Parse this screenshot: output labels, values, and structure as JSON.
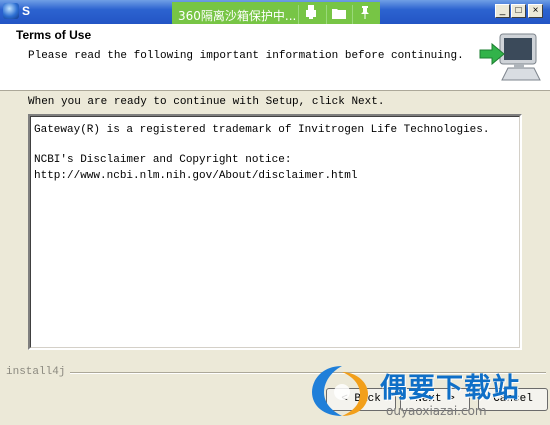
{
  "window": {
    "title": "S",
    "controls": {
      "minimize": "_",
      "maximize": "□",
      "close": "×"
    }
  },
  "sandbox_bar": {
    "text": "360隔离沙箱保护中...",
    "icons": [
      "usb-icon",
      "folder-icon",
      "pin-icon"
    ]
  },
  "header": {
    "title": "Terms of Use",
    "subtitle": "Please read the following important information before continuing."
  },
  "instruction": "When you are ready to continue with Setup, click Next.",
  "terms_text": [
    "Gateway(R) is a registered trademark of Invitrogen Life Technologies.",
    "",
    "NCBI's Disclaimer and Copyright notice:",
    "http://www.ncbi.nlm.nih.gov/About/disclaimer.html"
  ],
  "footer": {
    "brand": "install4j",
    "back_label": "< Back",
    "next_label": "Next >",
    "cancel_label": "Cancel"
  },
  "watermark": {
    "text": "偶要下载站",
    "url": "ouyaoxiazai.com"
  }
}
